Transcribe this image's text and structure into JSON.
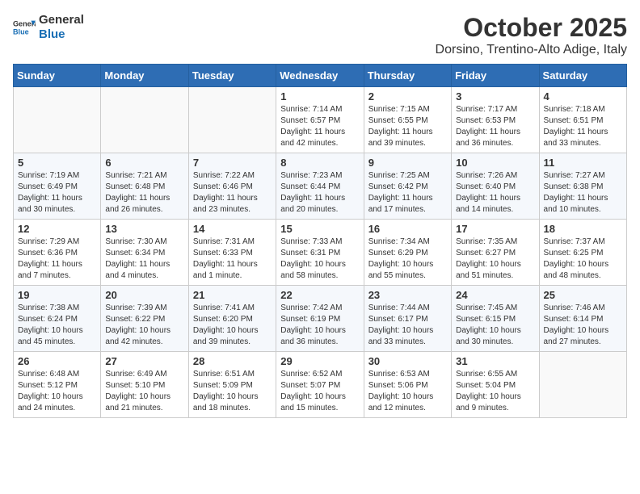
{
  "header": {
    "logo_general": "General",
    "logo_blue": "Blue",
    "month": "October 2025",
    "location": "Dorsino, Trentino-Alto Adige, Italy"
  },
  "days_of_week": [
    "Sunday",
    "Monday",
    "Tuesday",
    "Wednesday",
    "Thursday",
    "Friday",
    "Saturday"
  ],
  "weeks": [
    [
      {
        "day": "",
        "info": ""
      },
      {
        "day": "",
        "info": ""
      },
      {
        "day": "",
        "info": ""
      },
      {
        "day": "1",
        "info": "Sunrise: 7:14 AM\nSunset: 6:57 PM\nDaylight: 11 hours and 42 minutes."
      },
      {
        "day": "2",
        "info": "Sunrise: 7:15 AM\nSunset: 6:55 PM\nDaylight: 11 hours and 39 minutes."
      },
      {
        "day": "3",
        "info": "Sunrise: 7:17 AM\nSunset: 6:53 PM\nDaylight: 11 hours and 36 minutes."
      },
      {
        "day": "4",
        "info": "Sunrise: 7:18 AM\nSunset: 6:51 PM\nDaylight: 11 hours and 33 minutes."
      }
    ],
    [
      {
        "day": "5",
        "info": "Sunrise: 7:19 AM\nSunset: 6:49 PM\nDaylight: 11 hours and 30 minutes."
      },
      {
        "day": "6",
        "info": "Sunrise: 7:21 AM\nSunset: 6:48 PM\nDaylight: 11 hours and 26 minutes."
      },
      {
        "day": "7",
        "info": "Sunrise: 7:22 AM\nSunset: 6:46 PM\nDaylight: 11 hours and 23 minutes."
      },
      {
        "day": "8",
        "info": "Sunrise: 7:23 AM\nSunset: 6:44 PM\nDaylight: 11 hours and 20 minutes."
      },
      {
        "day": "9",
        "info": "Sunrise: 7:25 AM\nSunset: 6:42 PM\nDaylight: 11 hours and 17 minutes."
      },
      {
        "day": "10",
        "info": "Sunrise: 7:26 AM\nSunset: 6:40 PM\nDaylight: 11 hours and 14 minutes."
      },
      {
        "day": "11",
        "info": "Sunrise: 7:27 AM\nSunset: 6:38 PM\nDaylight: 11 hours and 10 minutes."
      }
    ],
    [
      {
        "day": "12",
        "info": "Sunrise: 7:29 AM\nSunset: 6:36 PM\nDaylight: 11 hours and 7 minutes."
      },
      {
        "day": "13",
        "info": "Sunrise: 7:30 AM\nSunset: 6:34 PM\nDaylight: 11 hours and 4 minutes."
      },
      {
        "day": "14",
        "info": "Sunrise: 7:31 AM\nSunset: 6:33 PM\nDaylight: 11 hours and 1 minute."
      },
      {
        "day": "15",
        "info": "Sunrise: 7:33 AM\nSunset: 6:31 PM\nDaylight: 10 hours and 58 minutes."
      },
      {
        "day": "16",
        "info": "Sunrise: 7:34 AM\nSunset: 6:29 PM\nDaylight: 10 hours and 55 minutes."
      },
      {
        "day": "17",
        "info": "Sunrise: 7:35 AM\nSunset: 6:27 PM\nDaylight: 10 hours and 51 minutes."
      },
      {
        "day": "18",
        "info": "Sunrise: 7:37 AM\nSunset: 6:25 PM\nDaylight: 10 hours and 48 minutes."
      }
    ],
    [
      {
        "day": "19",
        "info": "Sunrise: 7:38 AM\nSunset: 6:24 PM\nDaylight: 10 hours and 45 minutes."
      },
      {
        "day": "20",
        "info": "Sunrise: 7:39 AM\nSunset: 6:22 PM\nDaylight: 10 hours and 42 minutes."
      },
      {
        "day": "21",
        "info": "Sunrise: 7:41 AM\nSunset: 6:20 PM\nDaylight: 10 hours and 39 minutes."
      },
      {
        "day": "22",
        "info": "Sunrise: 7:42 AM\nSunset: 6:19 PM\nDaylight: 10 hours and 36 minutes."
      },
      {
        "day": "23",
        "info": "Sunrise: 7:44 AM\nSunset: 6:17 PM\nDaylight: 10 hours and 33 minutes."
      },
      {
        "day": "24",
        "info": "Sunrise: 7:45 AM\nSunset: 6:15 PM\nDaylight: 10 hours and 30 minutes."
      },
      {
        "day": "25",
        "info": "Sunrise: 7:46 AM\nSunset: 6:14 PM\nDaylight: 10 hours and 27 minutes."
      }
    ],
    [
      {
        "day": "26",
        "info": "Sunrise: 6:48 AM\nSunset: 5:12 PM\nDaylight: 10 hours and 24 minutes."
      },
      {
        "day": "27",
        "info": "Sunrise: 6:49 AM\nSunset: 5:10 PM\nDaylight: 10 hours and 21 minutes."
      },
      {
        "day": "28",
        "info": "Sunrise: 6:51 AM\nSunset: 5:09 PM\nDaylight: 10 hours and 18 minutes."
      },
      {
        "day": "29",
        "info": "Sunrise: 6:52 AM\nSunset: 5:07 PM\nDaylight: 10 hours and 15 minutes."
      },
      {
        "day": "30",
        "info": "Sunrise: 6:53 AM\nSunset: 5:06 PM\nDaylight: 10 hours and 12 minutes."
      },
      {
        "day": "31",
        "info": "Sunrise: 6:55 AM\nSunset: 5:04 PM\nDaylight: 10 hours and 9 minutes."
      },
      {
        "day": "",
        "info": ""
      }
    ]
  ]
}
